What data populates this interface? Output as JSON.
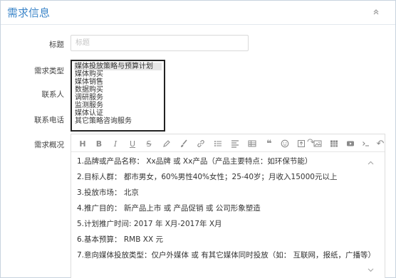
{
  "panel": {
    "title": "需求信息",
    "collapse_icon": "chevron-up-double-icon"
  },
  "form": {
    "title_label": "标题",
    "title_placeholder": "标题",
    "type_label": "需求类型",
    "contact_label": "联系人",
    "phone_label": "联系电话",
    "summary_label": "需求概况"
  },
  "type_options": [
    "媒体投放策略与预算计划",
    "媒体购买",
    "媒体销售",
    "数据购买",
    "调研服务",
    "监测服务",
    "媒体认证",
    "其它策略咨询服务"
  ],
  "type_selected": "媒体投放策略与预算计划",
  "toolbar": {
    "heading": "H",
    "bold": "B",
    "italic": "I",
    "underline": "U",
    "strike": "S",
    "undo": "↶",
    "redo": "↷"
  },
  "editor_lines": [
    "1.品牌或产品名称： Xx品牌 或 Xx产品（产品主要特点：如环保节能）",
    "2.目标人群： 都市男女，60%男性40%女性；25-40岁；月收入15000元以上",
    "3.投放市场： 北京",
    "4.推广目的： 新产品上市 或 产品促销 或 公司形象塑造",
    "5.计划推广时间: 2017 年 X月-2017年 X月",
    "6.基本预算： RMB XX 元",
    "7.意向媒体投放类型：仅户外媒体 或 有其它媒体同时投放（如： 互联网，报纸，广播等）"
  ],
  "colors": {
    "title": "#3d86c9",
    "border": "#c8d3df",
    "select_border": "#222222"
  }
}
